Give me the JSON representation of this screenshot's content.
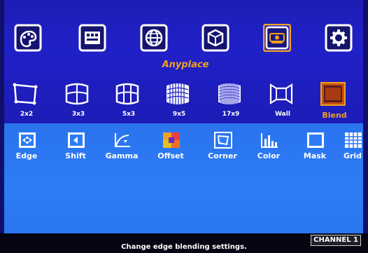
{
  "top_menu": {
    "items": [
      {
        "icon": "palette-icon"
      },
      {
        "icon": "input-panel-icon"
      },
      {
        "icon": "globe-icon"
      },
      {
        "icon": "3d-cube-icon"
      },
      {
        "icon": "projector-icon",
        "selected": true
      },
      {
        "icon": "gear-icon"
      }
    ],
    "selected_label": "Anyplace"
  },
  "layout_row": {
    "items": [
      {
        "label": "2x2"
      },
      {
        "label": "3x3"
      },
      {
        "label": "5x3"
      },
      {
        "label": "9x5"
      },
      {
        "label": "17x9"
      },
      {
        "label": "Wall"
      },
      {
        "label": "Blend",
        "active": true
      }
    ]
  },
  "sub_row": {
    "items": [
      {
        "label": "Edge"
      },
      {
        "label": "Shift"
      },
      {
        "label": "Gamma"
      },
      {
        "label": "Offset"
      },
      {
        "label": "Corner"
      },
      {
        "label": "Color"
      },
      {
        "label": "Mask"
      },
      {
        "label": "Grid"
      }
    ]
  },
  "status": {
    "channel": "CHANNEL 1",
    "hint": "Change edge blending settings."
  },
  "colors": {
    "top_panel": "#2020c8",
    "bottom_panel": "#2d7cf6",
    "accent": "#f0a020",
    "status_bar": "#050512"
  }
}
